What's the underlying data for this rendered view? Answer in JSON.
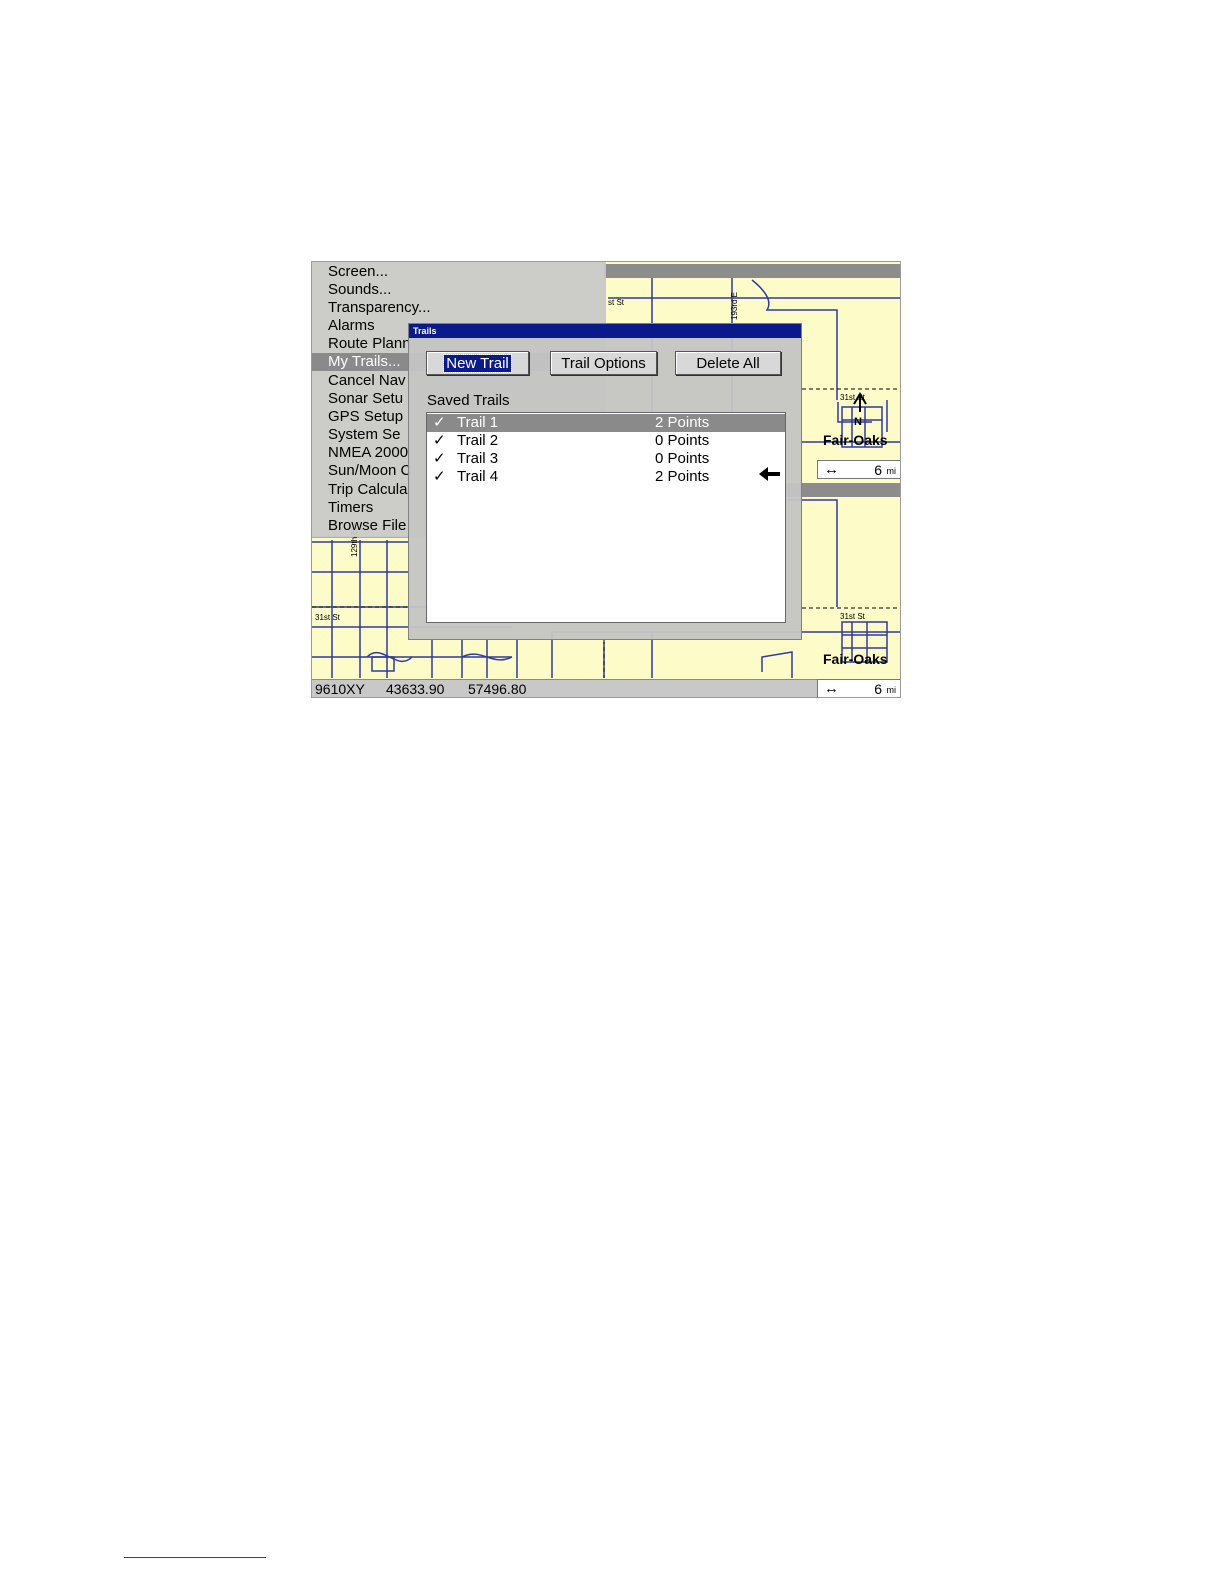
{
  "menu": {
    "items": [
      {
        "label": "Screen..."
      },
      {
        "label": "Sounds..."
      },
      {
        "label": "Transparency..."
      },
      {
        "label": "Alarms"
      },
      {
        "label": "Route Plann"
      },
      {
        "label": "My Trails...",
        "selected": true
      },
      {
        "label": "Cancel Nav"
      },
      {
        "label": "Sonar Setu"
      },
      {
        "label": "GPS Setup"
      },
      {
        "label": "System Se"
      },
      {
        "label": "NMEA 2000"
      },
      {
        "label": "Sun/Moon C"
      },
      {
        "label": "Trip Calcula"
      },
      {
        "label": "Timers"
      },
      {
        "label": "Browse File"
      }
    ]
  },
  "dialog": {
    "title": "Trails",
    "buttons": {
      "new_trail": "New Trail",
      "trail_options": "Trail Options",
      "delete_all": "Delete All"
    },
    "saved_label": "Saved Trails",
    "trails": [
      {
        "check": "✓",
        "name": "Trail 1",
        "points": "2 Points",
        "selected": true
      },
      {
        "check": "✓",
        "name": "Trail 2",
        "points": "0 Points"
      },
      {
        "check": "✓",
        "name": "Trail 3",
        "points": "0 Points"
      },
      {
        "check": "✓",
        "name": "Trail 4",
        "points": "2 Points"
      }
    ],
    "pointer_icon": "left-arrow-icon"
  },
  "map": {
    "top_panel": {
      "street_top": "st St",
      "street_vertical": "193rd E",
      "street_31st": "31st St",
      "north_label": "N",
      "city": "Fair-Oaks",
      "scale": {
        "arrow": "↔",
        "value": "6",
        "unit": "mi"
      }
    },
    "bottom_panel": {
      "street_129th": "129th E",
      "street_31st_left": "31st St",
      "street_31st_right": "31st St",
      "city": "Fair-Oaks",
      "scale": {
        "arrow": "↔",
        "value": "6",
        "unit": "mi"
      }
    },
    "colors": {
      "background": "#fdfcc8",
      "road": "#2f3aa0"
    }
  },
  "status_bar": {
    "position_name": "9610XY",
    "coord_x": "43633.90",
    "coord_y": "57496.80"
  }
}
